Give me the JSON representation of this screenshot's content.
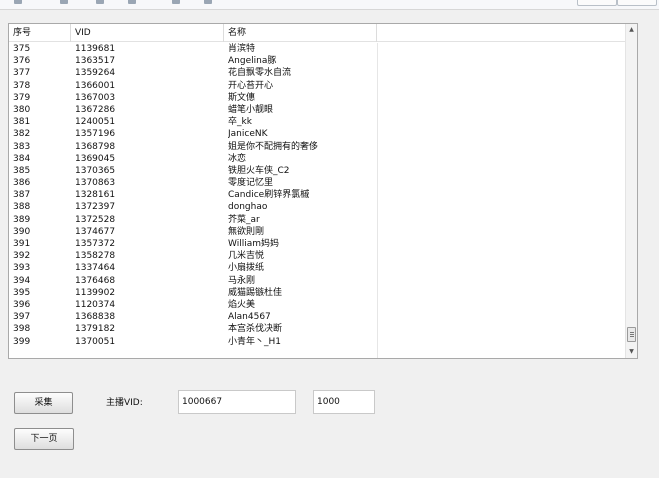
{
  "table": {
    "headers": {
      "seq": "序号",
      "vid": "VID",
      "name": "名称"
    },
    "rows": [
      {
        "seq": "375",
        "vid": "1139681",
        "name": "肖滨特"
      },
      {
        "seq": "376",
        "vid": "1363517",
        "name": "Angelina豚"
      },
      {
        "seq": "377",
        "vid": "1359264",
        "name": "花自飘零水自流"
      },
      {
        "seq": "378",
        "vid": "1366001",
        "name": "开心苔开心"
      },
      {
        "seq": "379",
        "vid": "1367003",
        "name": "斯文僡"
      },
      {
        "seq": "380",
        "vid": "1367286",
        "name": "蜡笔小靓眼"
      },
      {
        "seq": "381",
        "vid": "1240051",
        "name": "卒_kk"
      },
      {
        "seq": "382",
        "vid": "1357196",
        "name": "JaniceNK"
      },
      {
        "seq": "383",
        "vid": "1368798",
        "name": "姐是你不配拥有的奢侈"
      },
      {
        "seq": "384",
        "vid": "1369045",
        "name": "冰恋"
      },
      {
        "seq": "385",
        "vid": "1370365",
        "name": "铁胆火车侠_C2"
      },
      {
        "seq": "386",
        "vid": "1370863",
        "name": "零度记忆里"
      },
      {
        "seq": "387",
        "vid": "1328161",
        "name": "Candice刷锌界氯槭"
      },
      {
        "seq": "388",
        "vid": "1372397",
        "name": "donghao"
      },
      {
        "seq": "389",
        "vid": "1372528",
        "name": "芥菜_ar"
      },
      {
        "seq": "390",
        "vid": "1374677",
        "name": "無欲則剛"
      },
      {
        "seq": "391",
        "vid": "1357372",
        "name": "William妈妈"
      },
      {
        "seq": "392",
        "vid": "1358278",
        "name": "几米吉悦"
      },
      {
        "seq": "393",
        "vid": "1337464",
        "name": "小扇拨纸"
      },
      {
        "seq": "394",
        "vid": "1376468",
        "name": "马永刚"
      },
      {
        "seq": "395",
        "vid": "1139902",
        "name": "威猫踢镞杜佳"
      },
      {
        "seq": "396",
        "vid": "1120374",
        "name": "焰火美"
      },
      {
        "seq": "397",
        "vid": "1368838",
        "name": "Alan4567"
      },
      {
        "seq": "398",
        "vid": "1379182",
        "name": "本宫杀伐决断"
      },
      {
        "seq": "399",
        "vid": "1370051",
        "name": "小青年丶_H1"
      }
    ]
  },
  "controls": {
    "collect_label": "采集",
    "next_page_label": "下一页",
    "anchor_vid_label": "主播VID:",
    "anchor_vid_value": "1000667",
    "count_value": "1000"
  },
  "scrollbar": {
    "up_arrow": "▲",
    "down_arrow": "▼"
  }
}
